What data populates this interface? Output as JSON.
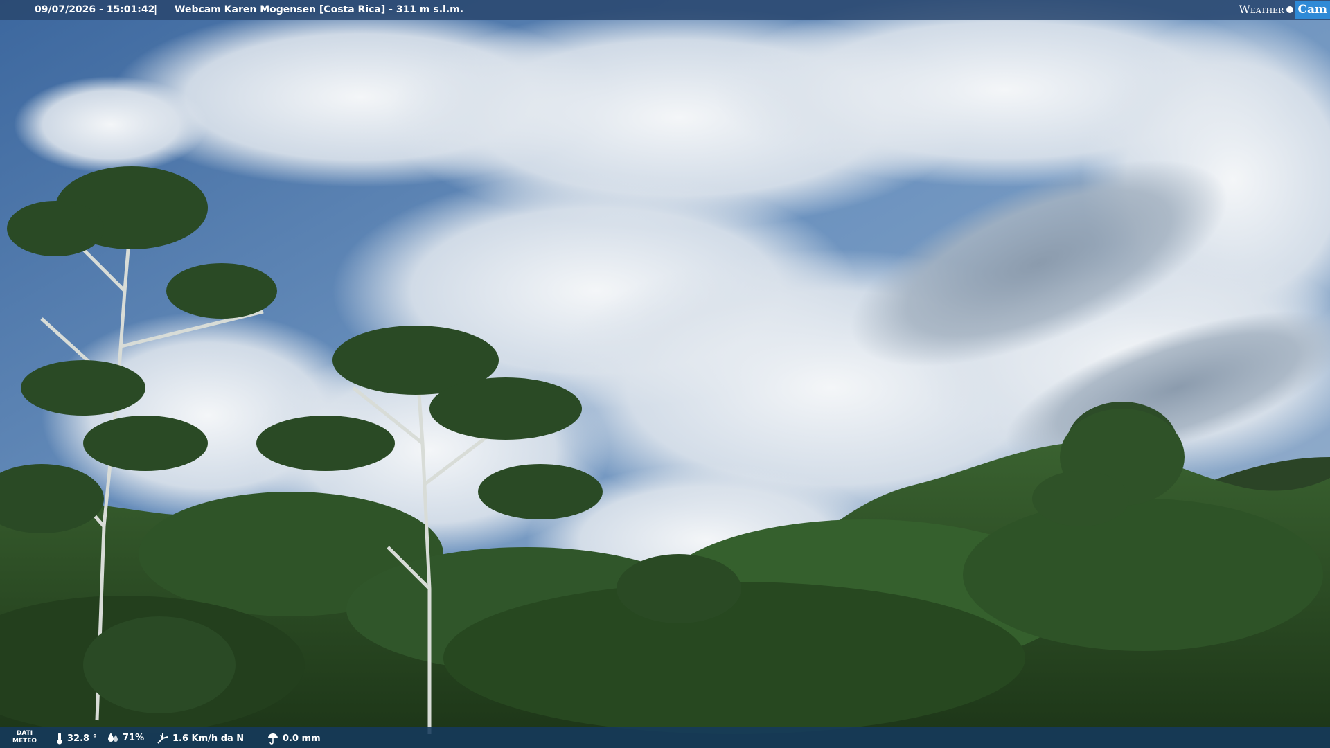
{
  "overlay": {
    "datetime": "09/07/2026 - 15:01:42",
    "separator": "|",
    "title": "Webcam Karen Mogensen [Costa Rica] - 311 m s.l.m."
  },
  "logo": {
    "part1": "Weather",
    "part2": "Cam"
  },
  "meteo": {
    "label_line1": "DATI",
    "label_line2": "METEO",
    "temperature": "32.8 °",
    "humidity": "71%",
    "wind": "1.6 Km/h da N",
    "rain": "0.0 mm"
  },
  "colors": {
    "sky": "#4a76ad",
    "cloud": "#e9eef3",
    "foliage": "#2c4f23",
    "bar": "#2a4870"
  }
}
